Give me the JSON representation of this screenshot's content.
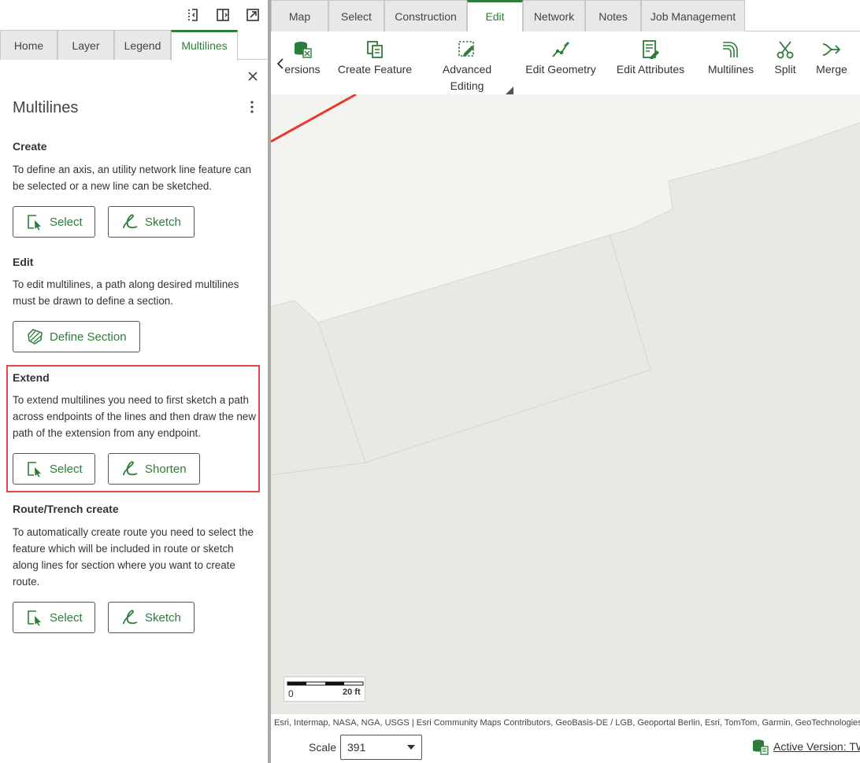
{
  "left_panel": {
    "tabs": [
      {
        "label": "Home"
      },
      {
        "label": "Layer"
      },
      {
        "label": "Legend"
      },
      {
        "label": "Multilines"
      }
    ],
    "title": "Multilines",
    "sections": {
      "create": {
        "title": "Create",
        "text": "To define an axis, an utility network line feature can be selected or a new line can be sketched.",
        "buttons": {
          "select": "Select",
          "sketch": "Sketch"
        }
      },
      "edit": {
        "title": "Edit",
        "text": "To edit multilines, a path along desired multilines must be drawn to define a section.",
        "buttons": {
          "define_section": "Define Section"
        }
      },
      "extend": {
        "title": "Extend",
        "text": "To extend multilines you need to first sketch a path across endpoints of the lines and then draw the new path of the extension from any endpoint.",
        "buttons": {
          "select": "Select",
          "shorten": "Shorten"
        }
      },
      "route": {
        "title": "Route/Trench create",
        "text": "To automatically create route you need to select the feature which will be included in route or sketch along lines for section where you want to create route.",
        "buttons": {
          "select": "Select",
          "sketch": "Sketch"
        }
      }
    }
  },
  "top_tabs": [
    {
      "label": "Map"
    },
    {
      "label": "Select"
    },
    {
      "label": "Construction"
    },
    {
      "label": "Edit"
    },
    {
      "label": "Network"
    },
    {
      "label": "Notes"
    },
    {
      "label": "Job Management"
    }
  ],
  "ribbon": {
    "versions": "ersions",
    "create_feature": "Create Feature",
    "advanced_editing_1": "Advanced",
    "advanced_editing_2": "Editing",
    "edit_geometry": "Edit Geometry",
    "edit_attributes": "Edit Attributes",
    "multilines": "Multilines",
    "split": "Split",
    "merge": "Merge"
  },
  "map": {
    "scale_zero": "0",
    "scale_distance": "20 ft",
    "attribution": "Esri, Intermap, NASA, NGA, USGS | Esri Community Maps Contributors, GeoBasis-DE / LGB, Geoportal Berlin, Esri, TomTom, Garmin, GeoTechnologies",
    "red_line_color": "#e53b2f"
  },
  "status": {
    "scale_label": "Scale",
    "scale_value": "391",
    "active_version": "Active Version: TW"
  },
  "colors": {
    "accent": "#2d7d3a",
    "highlight": "#e54848"
  }
}
